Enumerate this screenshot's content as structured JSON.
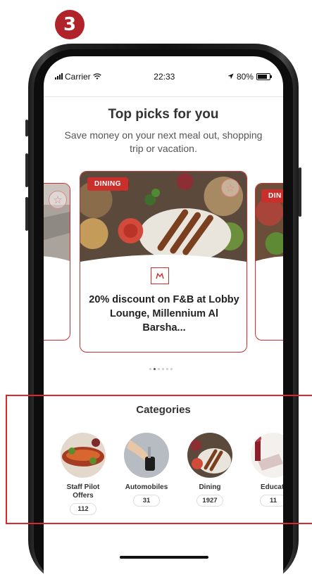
{
  "step_number": "3",
  "status_bar": {
    "carrier": "Carrier",
    "time": "22:33",
    "battery": "80%"
  },
  "top_picks": {
    "title": "Top picks for you",
    "subtitle": "Save money on your next meal out, shopping trip or vacation."
  },
  "cards": [
    {
      "badge": "DINING",
      "title": "20% discount on F&B at Lobby Lounge, Millennium Al Barsha...",
      "favorite_icon": "star-outline-icon"
    },
    {
      "badge": "DIN",
      "favorite_icon": "star-outline-icon"
    }
  ],
  "carousel": {
    "total": 6,
    "active": 1
  },
  "categories": {
    "title": "Categories",
    "items": [
      {
        "name": "Staff Pilot Offers",
        "count": "112"
      },
      {
        "name": "Automobiles",
        "count": "31"
      },
      {
        "name": "Dining",
        "count": "1927"
      },
      {
        "name": "Educati",
        "count": "11"
      }
    ]
  },
  "colors": {
    "accent": "#c9302c",
    "badge": "#b0232a",
    "highlight": "#e0262d"
  }
}
